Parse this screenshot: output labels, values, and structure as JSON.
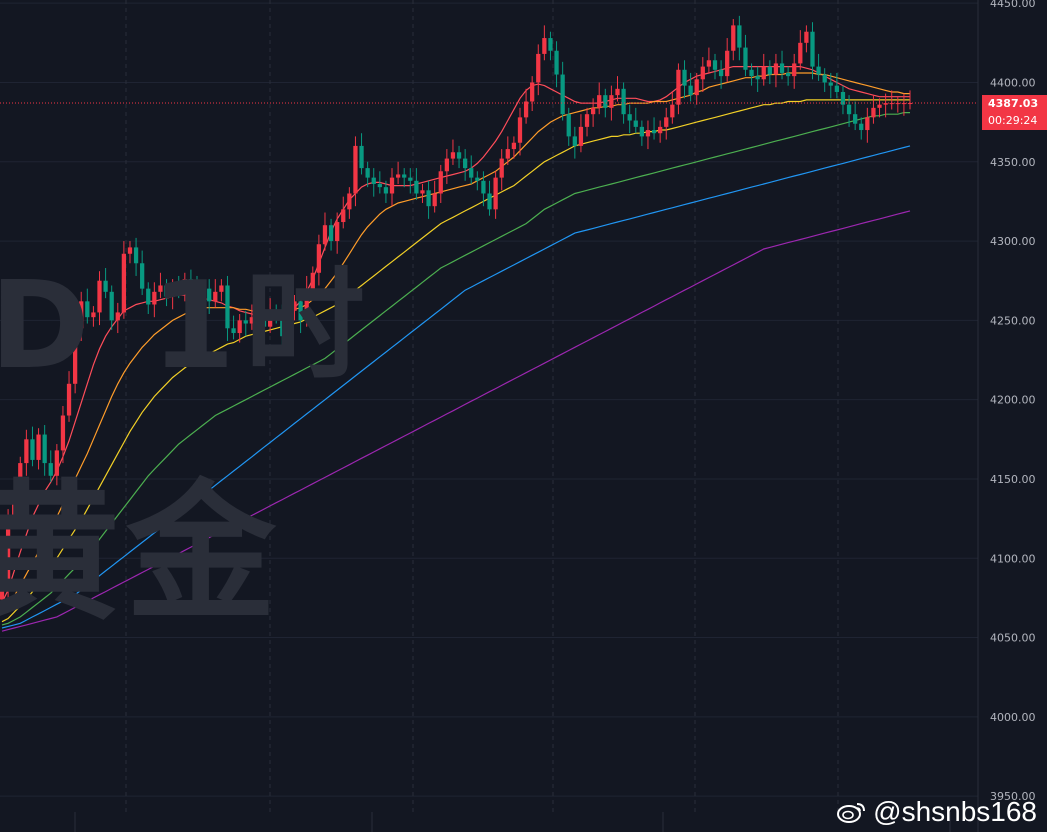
{
  "watermark": {
    "top_text": "D 1时",
    "bottom_text": "黄金"
  },
  "price_tag": {
    "price": "4387.03",
    "timer": "00:29:24"
  },
  "handle": "@shsnbs168",
  "colors": {
    "background": "#131722",
    "grid": "#1f2433",
    "up": "#f23645",
    "down": "#089981",
    "price_line": "#f23645",
    "axis_text": "#b2b5be"
  },
  "chart_data": {
    "type": "candlestick",
    "y_axis": {
      "min": 3940,
      "max": 4452,
      "ticks": [
        3950,
        4000,
        4050,
        4100,
        4150,
        4200,
        4250,
        4300,
        4350,
        4400,
        4450
      ],
      "tick_labels": [
        "3950.00",
        "4000.00",
        "4050.00",
        "4100.00",
        "4150.00",
        "4200.00",
        "4250.00",
        "4300.00",
        "4350.00",
        "4400.00",
        "4450.00"
      ]
    },
    "current_price": 4387.03,
    "bar_count": 150,
    "candles": [
      {
        "c": 4082
      },
      {
        "c": 4125
      },
      {
        "c": 4140
      },
      {
        "c": 4160
      },
      {
        "c": 4175
      },
      {
        "c": 4162
      },
      {
        "c": 4178
      },
      {
        "c": 4160
      },
      {
        "c": 4152
      },
      {
        "c": 4168
      },
      {
        "c": 4190
      },
      {
        "c": 4210
      },
      {
        "c": 4245
      },
      {
        "c": 4262
      },
      {
        "c": 4252
      },
      {
        "c": 4255
      },
      {
        "c": 4275
      },
      {
        "c": 4268
      },
      {
        "c": 4250
      },
      {
        "c": 4255
      },
      {
        "c": 4292
      },
      {
        "c": 4296
      },
      {
        "c": 4286
      },
      {
        "c": 4270
      },
      {
        "c": 4260
      },
      {
        "c": 4268
      },
      {
        "c": 4272
      },
      {
        "c": 4265
      },
      {
        "c": 4270
      },
      {
        "c": 4268
      },
      {
        "c": 4276
      },
      {
        "c": 4270
      },
      {
        "c": 4258
      },
      {
        "c": 4270
      },
      {
        "c": 4262
      },
      {
        "c": 4268
      },
      {
        "c": 4272
      },
      {
        "c": 4245
      },
      {
        "c": 4242
      },
      {
        "c": 4250
      },
      {
        "c": 4248
      },
      {
        "c": 4252
      },
      {
        "c": 4254
      },
      {
        "c": 4246
      },
      {
        "c": 4256
      },
      {
        "c": 4254
      },
      {
        "c": 4240
      },
      {
        "c": 4256
      },
      {
        "c": 4262
      },
      {
        "c": 4250
      },
      {
        "c": 4270
      },
      {
        "c": 4280
      },
      {
        "c": 4298
      },
      {
        "c": 4310
      },
      {
        "c": 4300
      },
      {
        "c": 4312
      },
      {
        "c": 4320
      },
      {
        "c": 4330
      },
      {
        "c": 4360
      },
      {
        "c": 4346
      },
      {
        "c": 4340
      },
      {
        "c": 4336
      },
      {
        "c": 4334
      },
      {
        "c": 4330
      },
      {
        "c": 4340
      },
      {
        "c": 4342
      },
      {
        "c": 4340
      },
      {
        "c": 4338
      },
      {
        "c": 4330
      },
      {
        "c": 4332
      },
      {
        "c": 4322
      },
      {
        "c": 4330
      },
      {
        "c": 4344
      },
      {
        "c": 4352
      },
      {
        "c": 4356
      },
      {
        "c": 4352
      },
      {
        "c": 4346
      },
      {
        "c": 4340
      },
      {
        "c": 4338
      },
      {
        "c": 4330
      },
      {
        "c": 4320
      },
      {
        "c": 4340
      },
      {
        "c": 4352
      },
      {
        "c": 4358
      },
      {
        "c": 4362
      },
      {
        "c": 4378
      },
      {
        "c": 4388
      },
      {
        "c": 4400
      },
      {
        "c": 4418
      },
      {
        "c": 4428
      },
      {
        "c": 4420
      },
      {
        "c": 4405
      },
      {
        "c": 4380
      },
      {
        "c": 4366
      },
      {
        "c": 4360
      },
      {
        "c": 4372
      },
      {
        "c": 4380
      },
      {
        "c": 4384
      },
      {
        "c": 4392
      },
      {
        "c": 4384
      },
      {
        "c": 4392
      },
      {
        "c": 4396
      },
      {
        "c": 4380
      },
      {
        "c": 4376
      },
      {
        "c": 4372
      },
      {
        "c": 4366
      },
      {
        "c": 4370
      },
      {
        "c": 4368
      },
      {
        "c": 4372
      },
      {
        "c": 4378
      },
      {
        "c": 4386
      },
      {
        "c": 4408
      },
      {
        "c": 4398
      },
      {
        "c": 4392
      },
      {
        "c": 4402
      },
      {
        "c": 4410
      },
      {
        "c": 4414
      },
      {
        "c": 4408
      },
      {
        "c": 4404
      },
      {
        "c": 4420
      },
      {
        "c": 4436
      },
      {
        "c": 4422
      },
      {
        "c": 4408
      },
      {
        "c": 4404
      },
      {
        "c": 4402
      },
      {
        "c": 4410
      },
      {
        "c": 4405
      },
      {
        "c": 4412
      },
      {
        "c": 4406
      },
      {
        "c": 4404
      },
      {
        "c": 4412
      },
      {
        "c": 4425
      },
      {
        "c": 4432
      },
      {
        "c": 4410
      },
      {
        "c": 4405
      },
      {
        "c": 4400
      },
      {
        "c": 4398
      },
      {
        "c": 4394
      },
      {
        "c": 4386
      },
      {
        "c": 4380
      },
      {
        "c": 4374
      },
      {
        "c": 4370
      },
      {
        "c": 4378
      },
      {
        "c": 4384
      },
      {
        "c": 4386
      },
      {
        "c": 4387
      },
      {
        "c": 4387
      },
      {
        "c": 4387
      },
      {
        "c": 4387
      },
      {
        "c": 4387.03
      }
    ],
    "ma_periods": [
      10,
      20,
      40,
      80,
      160,
      320
    ],
    "ma_colors": [
      "#ff4d5a",
      "#ff9d2a",
      "#f2d027",
      "#4caf50",
      "#2196f3",
      "#9c27b0"
    ],
    "ma_series": {
      "ma10": [
        4072,
        4080,
        4092,
        4104,
        4115,
        4126,
        4134,
        4142,
        4148,
        4155,
        4164,
        4174,
        4186,
        4198,
        4210,
        4222,
        4232,
        4240,
        4246,
        4251,
        4256,
        4258,
        4260,
        4261,
        4262,
        4262,
        4263,
        4264,
        4265,
        4266,
        4266,
        4267,
        4266,
        4264,
        4263,
        4262,
        4261,
        4259,
        4258,
        4256,
        4255,
        4254,
        4253,
        4252,
        4251,
        4252,
        4254,
        4256,
        4258,
        4262,
        4268,
        4276,
        4286,
        4296,
        4306,
        4314,
        4320,
        4326,
        4330,
        4334,
        4336,
        4337,
        4337,
        4336,
        4335,
        4335,
        4335,
        4335,
        4336,
        4337,
        4338,
        4339,
        4340,
        4341,
        4342,
        4343,
        4344,
        4346,
        4349,
        4353,
        4358,
        4363,
        4369,
        4376,
        4383,
        4390,
        4395,
        4398,
        4399,
        4398,
        4396,
        4394,
        4392,
        4390,
        4388,
        4387,
        4387,
        4387,
        4387,
        4388,
        4389,
        4390,
        4390,
        4390,
        4390,
        4389,
        4388,
        4388,
        4389,
        4391,
        4394,
        4397,
        4400,
        4402,
        4404,
        4405,
        4406,
        4407,
        4408,
        4409,
        4410,
        4410,
        4410,
        4410,
        4410,
        4410,
        4410,
        4410,
        4410,
        4410,
        4410,
        4410,
        4409,
        4408,
        4406,
        4404,
        4402,
        4400,
        4398,
        4396,
        4395,
        4394,
        4393,
        4392,
        4391,
        4391,
        4391,
        4391,
        4391,
        4391
      ],
      "ma20": [
        4066,
        4070,
        4076,
        4083,
        4090,
        4097,
        4104,
        4111,
        4118,
        4126,
        4134,
        4142,
        4150,
        4158,
        4166,
        4175,
        4184,
        4193,
        4202,
        4210,
        4217,
        4223,
        4228,
        4233,
        4237,
        4241,
        4244,
        4247,
        4250,
        4252,
        4254,
        4256,
        4257,
        4258,
        4258,
        4258,
        4258,
        4258,
        4258,
        4257,
        4257,
        4256,
        4255,
        4255,
        4255,
        4255,
        4256,
        4256,
        4257,
        4258,
        4260,
        4263,
        4266,
        4270,
        4275,
        4280,
        4286,
        4292,
        4298,
        4304,
        4309,
        4313,
        4317,
        4320,
        4322,
        4324,
        4325,
        4326,
        4327,
        4328,
        4329,
        4330,
        4331,
        4332,
        4333,
        4334,
        4335,
        4336,
        4338,
        4340,
        4342,
        4344,
        4347,
        4350,
        4353,
        4357,
        4361,
        4365,
        4369,
        4372,
        4375,
        4377,
        4379,
        4380,
        4381,
        4382,
        4383,
        4384,
        4384,
        4385,
        4385,
        4386,
        4386,
        4387,
        4387,
        4387,
        4387,
        4388,
        4388,
        4388,
        4389,
        4390,
        4391,
        4392,
        4394,
        4395,
        4397,
        4398,
        4399,
        4400,
        4401,
        4402,
        4403,
        4403,
        4404,
        4404,
        4405,
        4405,
        4405,
        4406,
        4406,
        4406,
        4406,
        4406,
        4405,
        4405,
        4404,
        4403,
        4402,
        4401,
        4400,
        4399,
        4398,
        4397,
        4396,
        4395,
        4394,
        4394,
        4393,
        4393
      ],
      "ma40": [
        4060,
        4062,
        4066,
        4070,
        4074,
        4079,
        4084,
        4089,
        4094,
        4100,
        4106,
        4112,
        4118,
        4124,
        4131,
        4138,
        4145,
        4152,
        4159,
        4166,
        4173,
        4180,
        4186,
        4192,
        4197,
        4202,
        4206,
        4210,
        4214,
        4217,
        4220,
        4223,
        4225,
        4227,
        4229,
        4231,
        4233,
        4235,
        4236,
        4238,
        4240,
        4241,
        4242,
        4243,
        4244,
        4245,
        4246,
        4247,
        4248,
        4249,
        4251,
        4252,
        4254,
        4256,
        4258,
        4260,
        4263,
        4266,
        4269,
        4272,
        4275,
        4278,
        4281,
        4284,
        4287,
        4290,
        4293,
        4296,
        4299,
        4302,
        4305,
        4308,
        4311,
        4313,
        4315,
        4317,
        4319,
        4321,
        4323,
        4325,
        4327,
        4329,
        4331,
        4333,
        4335,
        4338,
        4341,
        4344,
        4347,
        4350,
        4352,
        4354,
        4356,
        4358,
        4360,
        4361,
        4362,
        4363,
        4364,
        4365,
        4366,
        4366,
        4367,
        4367,
        4368,
        4368,
        4369,
        4369,
        4370,
        4370,
        4371,
        4372,
        4373,
        4374,
        4375,
        4376,
        4377,
        4378,
        4379,
        4380,
        4381,
        4382,
        4383,
        4384,
        4385,
        4386,
        4386,
        4387,
        4387,
        4388,
        4388,
        4388,
        4389,
        4389,
        4389,
        4389,
        4389,
        4389,
        4389,
        4389,
        4389,
        4389,
        4389,
        4389,
        4389,
        4389,
        4389,
        4389,
        4389,
        4389
      ],
      "ma80": [
        4058,
        4059,
        4061,
        4063,
        4066,
        4069,
        4072,
        4075,
        4078,
        4082,
        4086,
        4090,
        4094,
        4098,
        4102,
        4107,
        4112,
        4117,
        4122,
        4127,
        4132,
        4137,
        4142,
        4147,
        4152,
        4156,
        4160,
        4164,
        4168,
        4172,
        4175,
        4178,
        4181,
        4184,
        4187,
        4190,
        4192,
        4194,
        4196,
        4198,
        4200,
        4202,
        4204,
        4206,
        4208,
        4210,
        4212,
        4214,
        4216,
        4218,
        4220,
        4222,
        4224,
        4226,
        4229,
        4232,
        4235,
        4238,
        4241,
        4244,
        4247,
        4250,
        4253,
        4256,
        4259,
        4262,
        4265,
        4268,
        4271,
        4274,
        4277,
        4280,
        4283,
        4285,
        4287,
        4289,
        4291,
        4293,
        4295,
        4297,
        4299,
        4301,
        4303,
        4305,
        4307,
        4309,
        4311,
        4314,
        4317,
        4320,
        4322,
        4324,
        4326,
        4328,
        4330,
        4331,
        4332,
        4333,
        4334,
        4335,
        4336,
        4337,
        4338,
        4339,
        4340,
        4341,
        4342,
        4343,
        4344,
        4345,
        4346,
        4347,
        4348,
        4349,
        4350,
        4351,
        4352,
        4353,
        4354,
        4355,
        4356,
        4357,
        4358,
        4359,
        4360,
        4361,
        4362,
        4363,
        4364,
        4365,
        4366,
        4367,
        4368,
        4369,
        4370,
        4371,
        4372,
        4373,
        4374,
        4375,
        4376,
        4377,
        4378,
        4379,
        4379,
        4380,
        4380,
        4380,
        4381,
        4381
      ],
      "ma160": [
        4056,
        4057,
        4058,
        4059,
        4061,
        4063,
        4065,
        4067,
        4069,
        4071,
        4073,
        4075,
        4077,
        4080,
        4083,
        4086,
        4089,
        4092,
        4095,
        4098,
        4101,
        4104,
        4107,
        4110,
        4113,
        4116,
        4119,
        4122,
        4125,
        4128,
        4131,
        4134,
        4137,
        4140,
        4143,
        4146,
        4149,
        4152,
        4155,
        4158,
        4161,
        4164,
        4167,
        4170,
        4173,
        4176,
        4179,
        4182,
        4185,
        4188,
        4191,
        4194,
        4197,
        4200,
        4203,
        4206,
        4209,
        4212,
        4215,
        4218,
        4221,
        4224,
        4227,
        4230,
        4233,
        4236,
        4239,
        4242,
        4245,
        4248,
        4251,
        4254,
        4257,
        4260,
        4263,
        4266,
        4269,
        4271,
        4273,
        4275,
        4277,
        4279,
        4281,
        4283,
        4285,
        4287,
        4289,
        4291,
        4293,
        4295,
        4297,
        4299,
        4301,
        4303,
        4305,
        4306,
        4307,
        4308,
        4309,
        4310,
        4311,
        4312,
        4313,
        4314,
        4315,
        4316,
        4317,
        4318,
        4319,
        4320,
        4321,
        4322,
        4323,
        4324,
        4325,
        4326,
        4327,
        4328,
        4329,
        4330,
        4331,
        4332,
        4333,
        4334,
        4335,
        4336,
        4337,
        4338,
        4339,
        4340,
        4341,
        4342,
        4343,
        4344,
        4345,
        4346,
        4347,
        4348,
        4349,
        4350,
        4351,
        4352,
        4353,
        4354,
        4355,
        4356,
        4357,
        4358,
        4359,
        4360
      ],
      "ma320": [
        4054,
        4055,
        4056,
        4057,
        4058,
        4059,
        4060,
        4061,
        4062,
        4063,
        4065,
        4067,
        4069,
        4071,
        4073,
        4075,
        4077,
        4079,
        4081,
        4083,
        4085,
        4087,
        4089,
        4091,
        4093,
        4095,
        4097,
        4099,
        4101,
        4103,
        4105,
        4107,
        4109,
        4111,
        4113,
        4115,
        4117,
        4119,
        4121,
        4123,
        4125,
        4127,
        4129,
        4131,
        4133,
        4135,
        4137,
        4139,
        4141,
        4143,
        4145,
        4147,
        4149,
        4151,
        4153,
        4155,
        4157,
        4159,
        4161,
        4163,
        4165,
        4167,
        4169,
        4171,
        4173,
        4175,
        4177,
        4179,
        4181,
        4183,
        4185,
        4187,
        4189,
        4191,
        4193,
        4195,
        4197,
        4199,
        4201,
        4203,
        4205,
        4207,
        4209,
        4211,
        4213,
        4215,
        4217,
        4219,
        4221,
        4223,
        4225,
        4227,
        4229,
        4231,
        4233,
        4235,
        4237,
        4239,
        4241,
        4243,
        4245,
        4247,
        4249,
        4251,
        4253,
        4255,
        4257,
        4259,
        4261,
        4263,
        4265,
        4267,
        4269,
        4271,
        4273,
        4275,
        4277,
        4279,
        4281,
        4283,
        4285,
        4287,
        4289,
        4291,
        4293,
        4295,
        4296,
        4297,
        4298,
        4299,
        4300,
        4301,
        4302,
        4303,
        4304,
        4305,
        4306,
        4307,
        4308,
        4309,
        4310,
        4311,
        4312,
        4313,
        4314,
        4315,
        4316,
        4317,
        4318,
        4319
      ]
    }
  }
}
